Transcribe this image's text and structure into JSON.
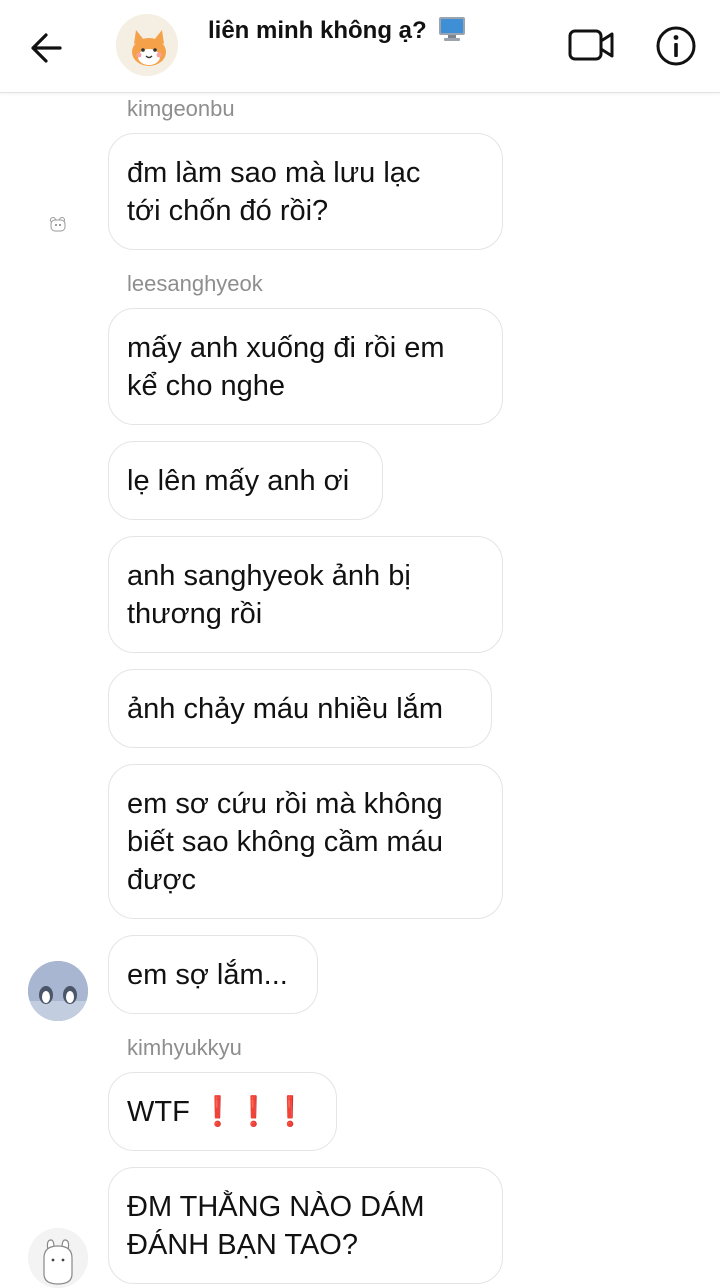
{
  "header": {
    "back_icon": "arrow-left-icon",
    "title": "liên minh không ạ?",
    "title_emoji_icon": "desktop-computer-icon",
    "video_icon": "video-camera-icon",
    "info_icon": "info-circle-icon"
  },
  "messages": [
    {
      "sender": "kimgeonbu",
      "lines": [
        "đm làm sao mà lưu lạc",
        "tới chốn đó rồi?"
      ]
    },
    {
      "sender": "leesanghyeok",
      "lines": [
        "mấy anh xuống đi rồi em",
        "kể cho nghe"
      ]
    },
    {
      "lines": [
        "lẹ lên mấy anh ơi"
      ]
    },
    {
      "lines": [
        "anh sanghyeok ảnh bị",
        "thương rồi"
      ]
    },
    {
      "lines": [
        "ảnh chảy máu nhiều lắm"
      ]
    },
    {
      "lines": [
        "em sơ cứu rồi mà không",
        "biết sao không cầm máu",
        "được"
      ]
    },
    {
      "lines": [
        "em sợ lắm..."
      ]
    },
    {
      "sender": "kimhyukkyu",
      "lines": [
        "WTF"
      ],
      "suffix": "❗❗❗"
    },
    {
      "lines": [
        "ĐM THẰNG NÀO DÁM",
        "ĐÁNH BẠN TAO?"
      ]
    }
  ],
  "colors": {
    "bubble_border": "#e4e4e4",
    "sender_text": "#8e8e8e",
    "exclamation": "#e0281e"
  }
}
